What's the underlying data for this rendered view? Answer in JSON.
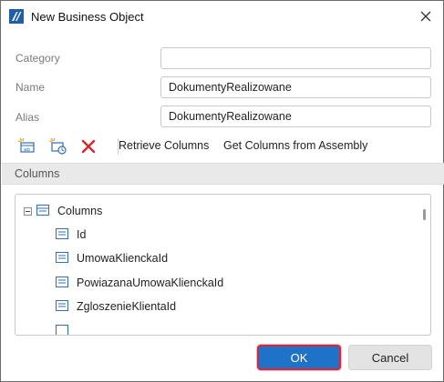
{
  "window": {
    "title": "New Business Object",
    "close_glyph": "✕"
  },
  "form": {
    "category": {
      "label": "Category",
      "value": ""
    },
    "name": {
      "label": "Name",
      "value": "DokumentyRealizowane"
    },
    "alias": {
      "label": "Alias",
      "value": "DokumentyRealizowane"
    }
  },
  "toolbar": {
    "add_column_icon": "add-column-icon",
    "add_calculated_column_icon": "add-calculated-column-icon",
    "delete_icon": "delete-icon",
    "delete_color": "#d9262b",
    "retrieve_columns_label": "Retrieve Columns",
    "get_columns_from_assembly_label": "Get Columns from Assembly"
  },
  "columns_section": {
    "title": "Columns",
    "root_label": "Columns",
    "items": [
      "Id",
      "UmowaKlienckaId",
      "PowiazanaUmowaKlienckaId",
      "ZgloszenieKlientaId"
    ]
  },
  "buttons": {
    "ok_label": "OK",
    "cancel_label": "Cancel"
  },
  "colors": {
    "ok_background": "#1e73c8",
    "ok_focus_border": "#d6283b",
    "icon_blue": "#2f6fb5"
  }
}
